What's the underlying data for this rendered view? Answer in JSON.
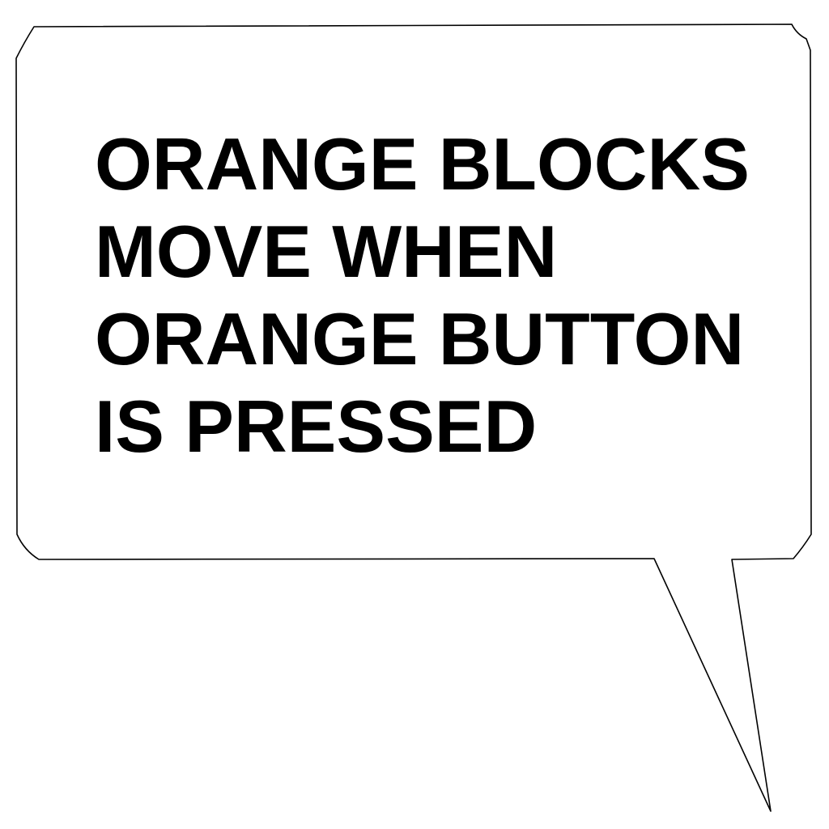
{
  "speech_bubble": {
    "lines": [
      "ORANGE BLOCKS",
      "MOVE WHEN",
      "ORANGE BUTTON",
      "IS PRESSED"
    ]
  },
  "colors": {
    "background": "#ffffff",
    "outline": "#000000",
    "text": "#000000"
  }
}
